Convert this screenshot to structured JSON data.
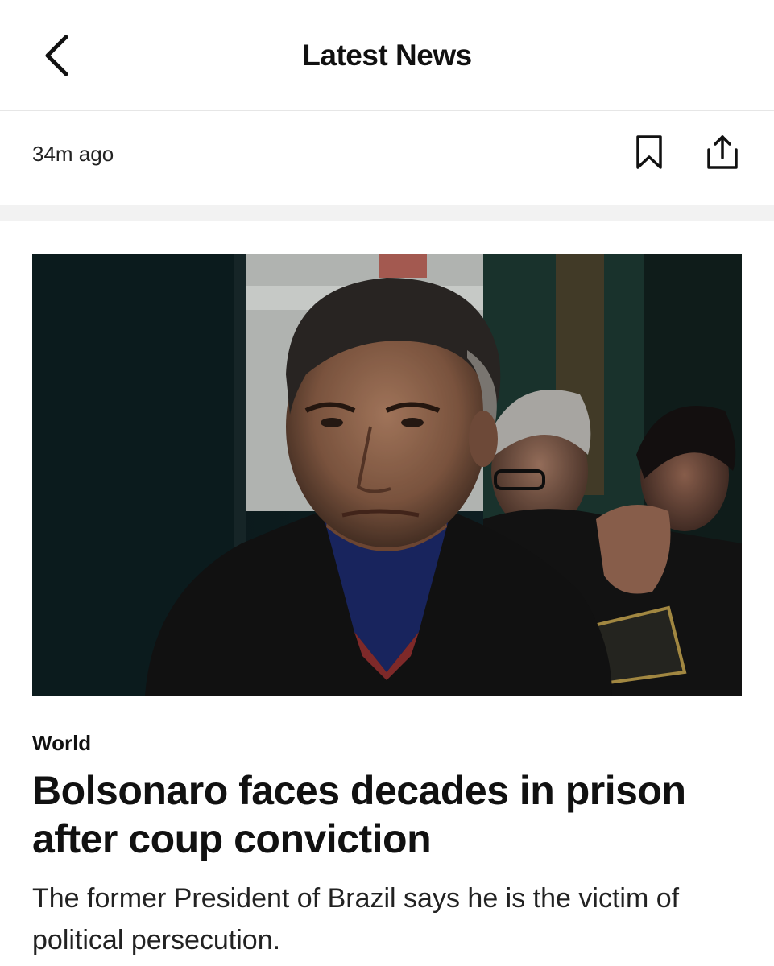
{
  "header": {
    "back_icon": "chevron-left-icon",
    "title": "Latest News"
  },
  "meta": {
    "timestamp": "34m ago",
    "bookmark_icon": "bookmark-icon",
    "share_icon": "share-icon"
  },
  "article": {
    "image_description_icon": "photo",
    "category": "World",
    "headline": "Bolsonaro faces decades in prison after coup conviction",
    "summary": "The former President of Brazil says he is the victim of political persecution."
  },
  "colors": {
    "text_primary": "#111111",
    "background": "#ffffff",
    "divider": "#f2f2f2"
  }
}
